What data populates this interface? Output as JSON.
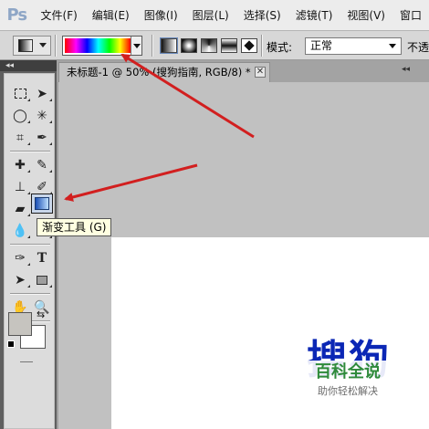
{
  "app": {
    "logo": "Ps"
  },
  "menu": {
    "items": [
      "文件(F)",
      "编辑(E)",
      "图像(I)",
      "图层(L)",
      "选择(S)",
      "滤镜(T)",
      "视图(V)",
      "窗口"
    ]
  },
  "options": {
    "mode_label": "模式:",
    "mode_value": "正常",
    "opacity_label": "不透"
  },
  "toolbox": {
    "collapse_glyph": "◂◂",
    "tooltip": "渐变工具 (G)",
    "foreground_color": "#c6c4bf",
    "background_color": "#ffffff"
  },
  "document": {
    "tab_title": "未标题-1 @ 50% (搜狗指南, RGB/8) *",
    "close_glyph": "✕",
    "collapse_glyph": "◂◂"
  },
  "watermark": {
    "big_text": "搜狗",
    "title": "百科全说",
    "subtitle": "助你轻松解决"
  },
  "colors": {
    "annotation_arrow": "#d21f1f",
    "watermark_blue": "#0b27b5",
    "watermark_green": "#2e8a3a"
  }
}
